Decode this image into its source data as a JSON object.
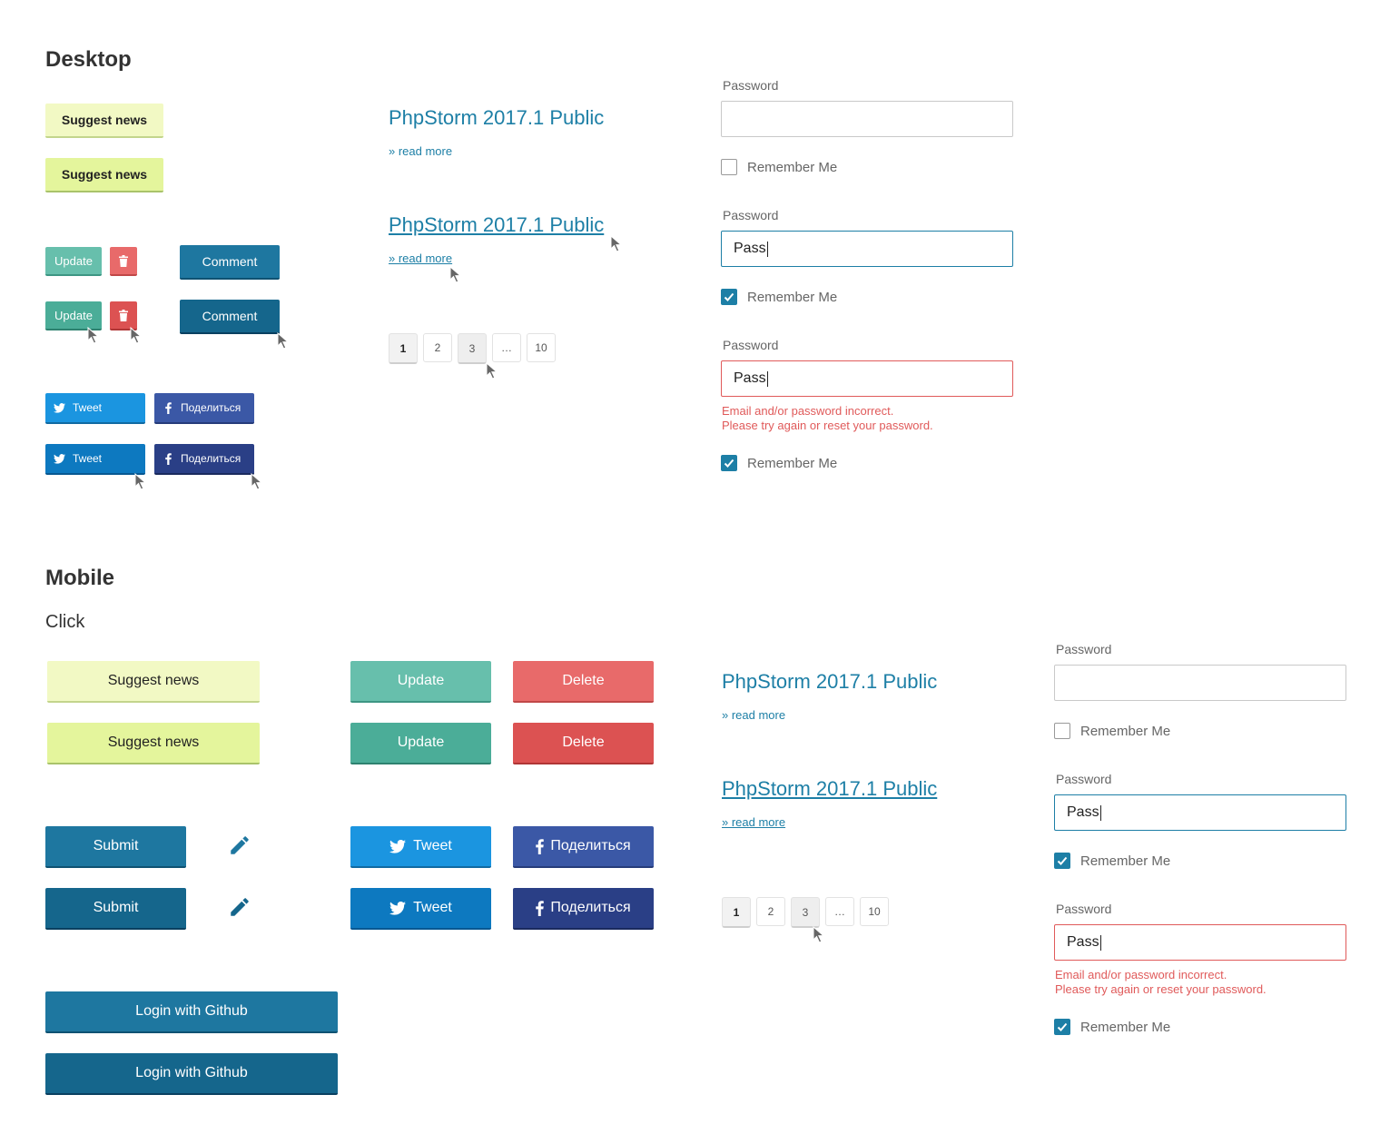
{
  "sections": {
    "desktop": "Desktop",
    "mobile": "Mobile",
    "mobile_sub": "Click"
  },
  "buttons": {
    "suggest": "Suggest news",
    "update": "Update",
    "comment": "Comment",
    "tweet": "Tweet",
    "share": "Поделиться",
    "delete": "Delete",
    "submit": "Submit",
    "login_github": "Login with Github"
  },
  "news": {
    "title": "PhpStorm 2017.1 Public",
    "read_more": "» read more"
  },
  "pagination": {
    "pages": [
      "1",
      "2",
      "3",
      "…",
      "10"
    ],
    "active": "1",
    "hover": "3"
  },
  "form": {
    "password_label": "Password",
    "remember_label": "Remember Me",
    "typed_value": "Pass",
    "error_line1": "Email and/or password incorrect.",
    "error_line2": "Please try again or reset your password."
  },
  "colors": {
    "link": "#1d7fa6",
    "primary": "#1e77a0",
    "error": "#e05a5a",
    "suggest": "#f2f9c4",
    "update": "#67bfac",
    "delete": "#e86a6a",
    "twitter": "#1b95e0",
    "facebook": "#3b58a6"
  },
  "icons": [
    "twitter-icon",
    "facebook-icon",
    "trash-icon",
    "pencil-icon",
    "cursor-icon",
    "checkmark-icon"
  ]
}
